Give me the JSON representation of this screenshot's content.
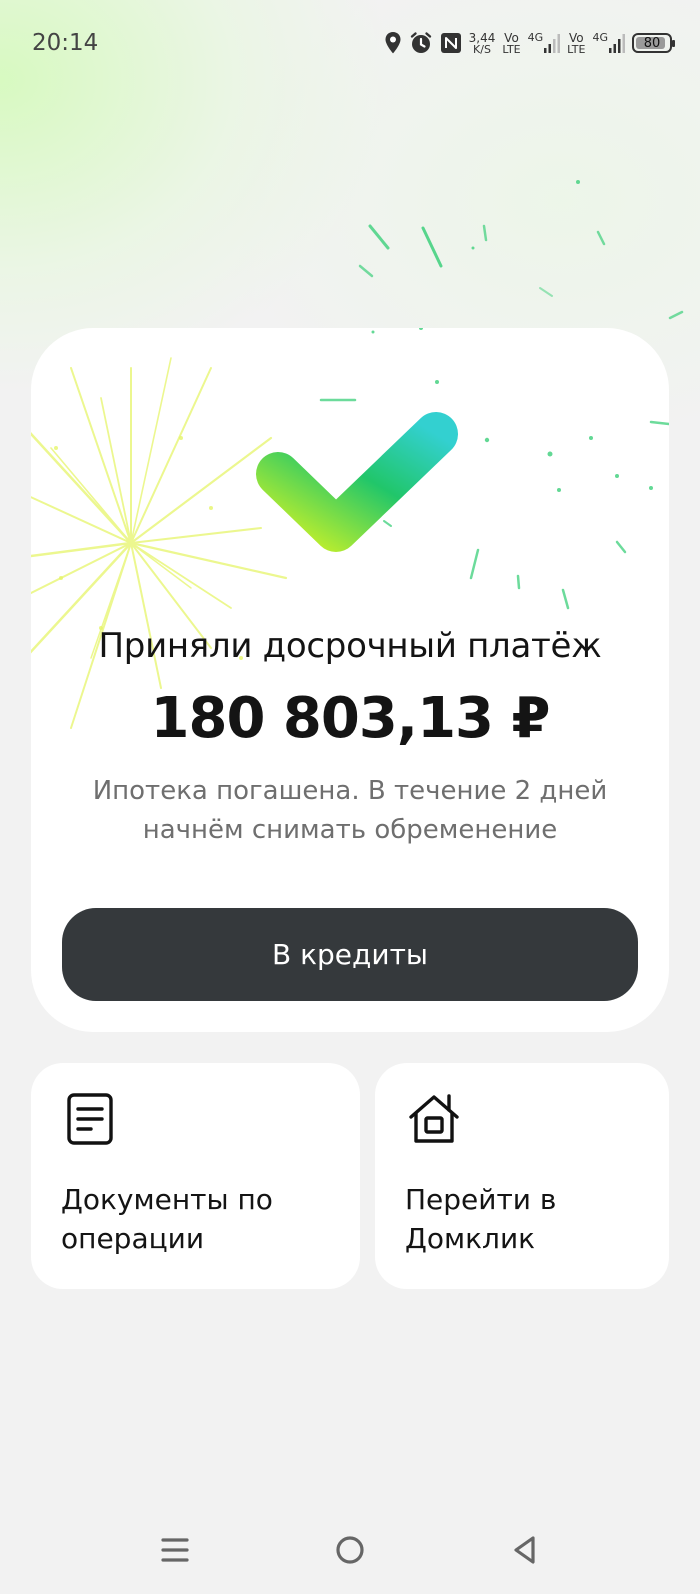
{
  "status_bar": {
    "time": "20:14",
    "speed_value": "3,44",
    "speed_unit": "K/S",
    "sim1_volte_top": "Vo",
    "sim1_volte_bottom": "LTE",
    "sim1_network": "4G",
    "sim2_volte_top": "Vo",
    "sim2_volte_bottom": "LTE",
    "sim2_network": "4G",
    "battery_level": "80",
    "icons": [
      "location-icon",
      "alarm-icon",
      "nfc-icon",
      "signal-icon",
      "battery-icon"
    ]
  },
  "result_card": {
    "title": "Приняли досрочный платёж",
    "amount": "180 803,13 ₽",
    "subtitle": "Ипотека погашена. В течение 2 дней начнём снимать обременение",
    "button_label": "В кредиты",
    "icon": "checkmark-icon"
  },
  "actions": [
    {
      "label": "Документы по операции",
      "icon": "document-icon"
    },
    {
      "label": "Перейти в Домклик",
      "icon": "house-icon"
    }
  ],
  "nav_bar": {
    "icons": [
      "menu-icon",
      "home-circle-icon",
      "back-triangle-icon"
    ]
  },
  "colors": {
    "button_bg": "#35393c",
    "card_bg": "#ffffff",
    "page_bg": "#f2f2f2",
    "check_gradient_start": "#c6f02a",
    "check_gradient_mid": "#21c66a",
    "check_gradient_end": "#33d0d0"
  }
}
